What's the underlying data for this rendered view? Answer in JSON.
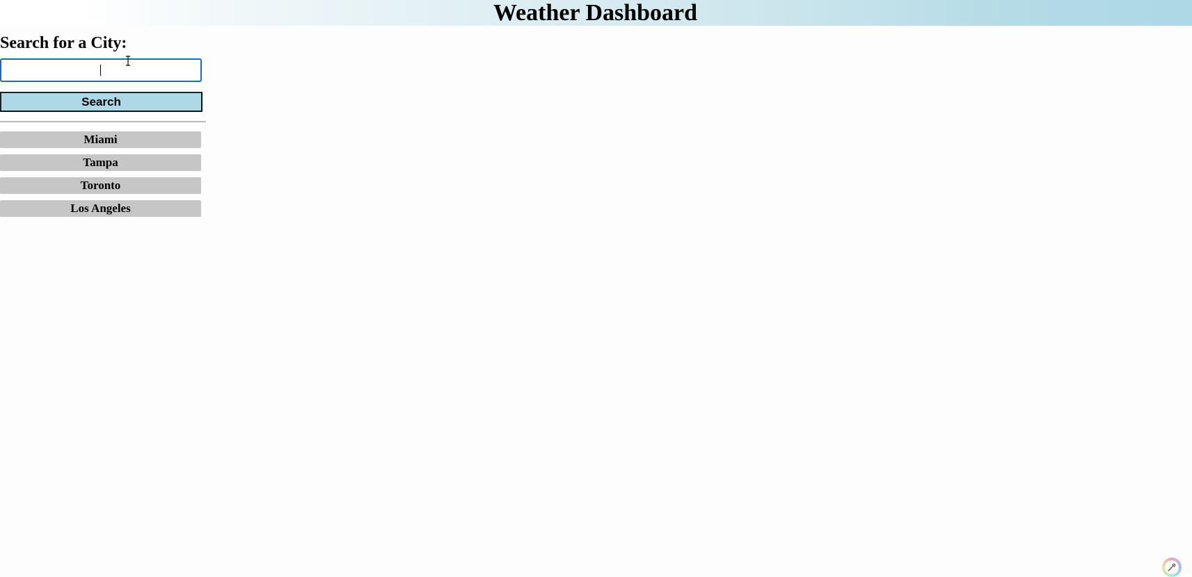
{
  "header": {
    "title": "Weather Dashboard"
  },
  "search": {
    "label": "Search for a City:",
    "input_value": "",
    "placeholder": "",
    "button_label": "Search"
  },
  "history": {
    "cities": [
      {
        "label": "Miami"
      },
      {
        "label": "Tampa"
      },
      {
        "label": "Toronto"
      },
      {
        "label": "Los Angeles"
      }
    ]
  },
  "colors": {
    "header_gradient_end": "#add8e6",
    "search_button_bg": "#add8e6",
    "history_button_bg": "#c6c6c6",
    "input_focus_border": "#1a66c9"
  },
  "icons": {
    "text_cursor": "ibeam-cursor-icon",
    "corner": "color-picker-icon"
  }
}
